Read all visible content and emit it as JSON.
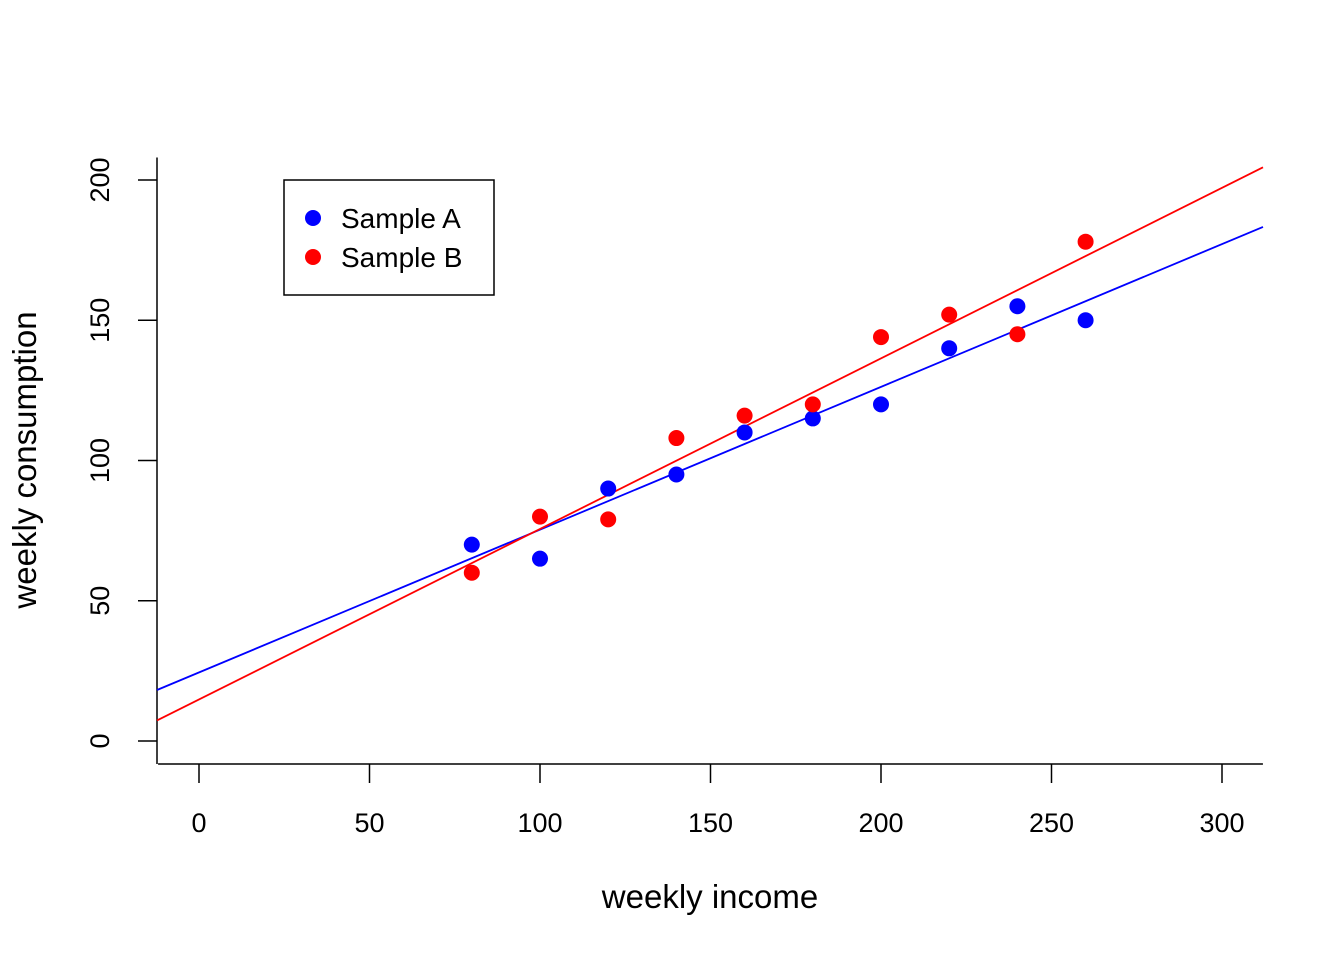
{
  "chart_data": {
    "type": "scatter",
    "title": "",
    "xlabel": "weekly income",
    "ylabel": "weekly consumption",
    "xlim": [
      -12,
      312
    ],
    "ylim": [
      -8,
      208
    ],
    "xticks": [
      0,
      50,
      100,
      150,
      200,
      250,
      300
    ],
    "yticks": [
      0,
      50,
      100,
      150,
      200
    ],
    "grid": false,
    "legend": {
      "placement": "top-left",
      "entries": [
        "Sample A",
        "Sample B"
      ]
    },
    "series": [
      {
        "name": "Sample A",
        "color": "#0000ff",
        "x": [
          80,
          100,
          120,
          140,
          160,
          180,
          200,
          220,
          240,
          260
        ],
        "y": [
          70,
          65,
          90,
          95,
          110,
          115,
          120,
          140,
          155,
          150
        ],
        "fit": {
          "intercept": 24.45,
          "slope": 0.509
        }
      },
      {
        "name": "Sample B",
        "color": "#ff0000",
        "x": [
          80,
          100,
          120,
          140,
          160,
          180,
          200,
          220,
          240,
          260
        ],
        "y": [
          60,
          80,
          79,
          108,
          116,
          120,
          144,
          152,
          145,
          178
        ],
        "fit": {
          "intercept": 14.8,
          "slope": 0.608
        }
      }
    ]
  }
}
